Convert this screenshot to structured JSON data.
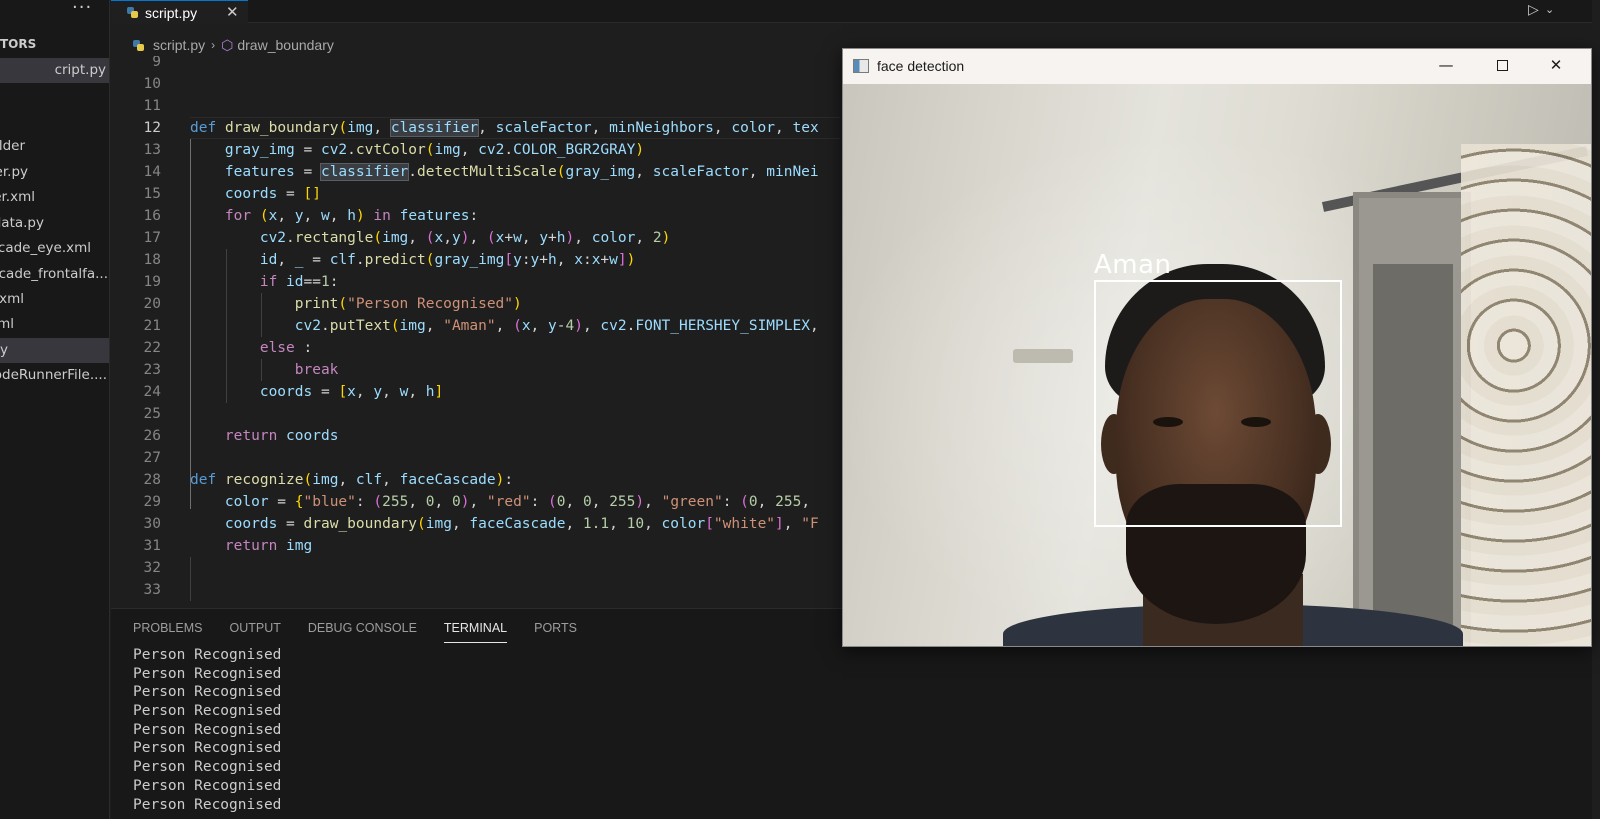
{
  "sidebar": {
    "more": "···",
    "section": "TORS",
    "items": [
      {
        "label": "cript.py",
        "selected": true
      },
      {
        "label": "lder",
        "selected": false
      },
      {
        "label": "er.py",
        "selected": false
      },
      {
        "label": "er.xml",
        "selected": false
      },
      {
        "label": "data.py",
        "selected": false
      },
      {
        "label": "scade_eye.xml",
        "selected": false
      },
      {
        "label": "scade_frontalfa...",
        "selected": false
      },
      {
        "label": "xml",
        "selected": false
      },
      {
        "label": "ml",
        "selected": false
      },
      {
        "label": "y",
        "selected": true
      },
      {
        "label": "odeRunnerFile....",
        "selected": false
      }
    ]
  },
  "tabs": [
    {
      "label": "script.py",
      "close": "✕"
    }
  ],
  "toolbar": {
    "run": "▷",
    "chevron": "⌄"
  },
  "breadcrumb": {
    "file": "script.py",
    "symbol": "draw_boundary",
    "sep": "›"
  },
  "editor": {
    "line_numbers": [
      "9",
      "10",
      "11",
      "12",
      "13",
      "14",
      "15",
      "16",
      "17",
      "18",
      "19",
      "20",
      "21",
      "22",
      "23",
      "24",
      "25",
      "26",
      "27",
      "28",
      "29",
      "30",
      "31",
      "32",
      "33"
    ],
    "current_line": "12"
  },
  "panel": {
    "tabs": [
      "PROBLEMS",
      "OUTPUT",
      "DEBUG CONSOLE",
      "TERMINAL",
      "PORTS"
    ],
    "active_tab": "TERMINAL",
    "terminal_lines": [
      "Person Recognised",
      "Person Recognised",
      "Person Recognised",
      "Person Recognised",
      "Person Recognised",
      "Person Recognised",
      "Person Recognised",
      "Person Recognised",
      "Person Recognised"
    ]
  },
  "window": {
    "title": "face detection",
    "minimize": "—",
    "close": "✕",
    "detection_label": "Aman"
  },
  "colors": {
    "accent": "#0078d4",
    "editor_bg": "#1e1e1e",
    "sidebar_bg": "#181818"
  }
}
